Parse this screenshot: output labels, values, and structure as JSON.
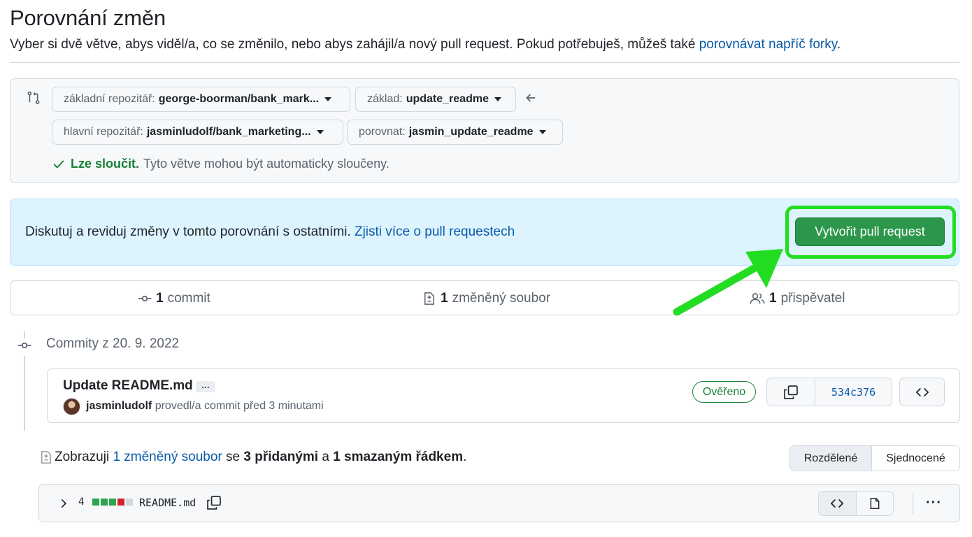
{
  "page": {
    "title": "Porovnání změn",
    "subtitle_prefix": "Vyber si dvě větve, abys viděl/a, co se změnilo, nebo abys zahájil/a nový pull request. Pokud potřebuješ, můžeš také ",
    "subtitle_link": "porovnávat napříč forky",
    "subtitle_suffix": "."
  },
  "range": {
    "base_repo_label": "základní repozitář:",
    "base_repo_value": "george-boorman/bank_mark...",
    "base_label": "základ:",
    "base_value": "update_readme",
    "head_repo_label": "hlavní repozitář:",
    "head_repo_value": "jasminludolf/bank_marketing...",
    "compare_label": "porovnat:",
    "compare_value": "jasmin_update_readme",
    "merge_status": "Lze sloučit.",
    "merge_text": "Tyto větve mohou být automaticky sloučeny."
  },
  "flash": {
    "text": "Diskutuj a reviduj změny v tomto porovnání s ostatními.",
    "link": "Zjisti více o pull requestech",
    "button": "Vytvořit pull request"
  },
  "stats": {
    "commits_count": "1",
    "commits_label": "commit",
    "files_count": "1",
    "files_label": "změněný soubor",
    "contributors_count": "1",
    "contributors_label": "přispěvatel"
  },
  "timeline": {
    "date_heading": "Commity z 20. 9. 2022"
  },
  "commit": {
    "title": "Update README.md",
    "more": "…",
    "author": "jasminludolf",
    "meta": "provedl/a commit před 3 minutami",
    "verified": "Ověřeno",
    "sha": "534c376"
  },
  "diff": {
    "prefix": "Zobrazuji",
    "files_link": "1 změněný soubor",
    "mid1": "se",
    "additions": "3 přidanými",
    "mid2": "a",
    "deletions": "1 smazaným řádkem",
    "end": ".",
    "view_split": "Rozdělené",
    "view_unified": "Sjednocené"
  },
  "file": {
    "changes": "4",
    "name": "README.md",
    "diffstat_additions": 3,
    "diffstat_deletions": 1
  },
  "colors": {
    "accent_green": "#2c974b",
    "highlight": "#22dd22",
    "link": "#0a5aa8",
    "flash_bg": "#ddf4ff"
  }
}
